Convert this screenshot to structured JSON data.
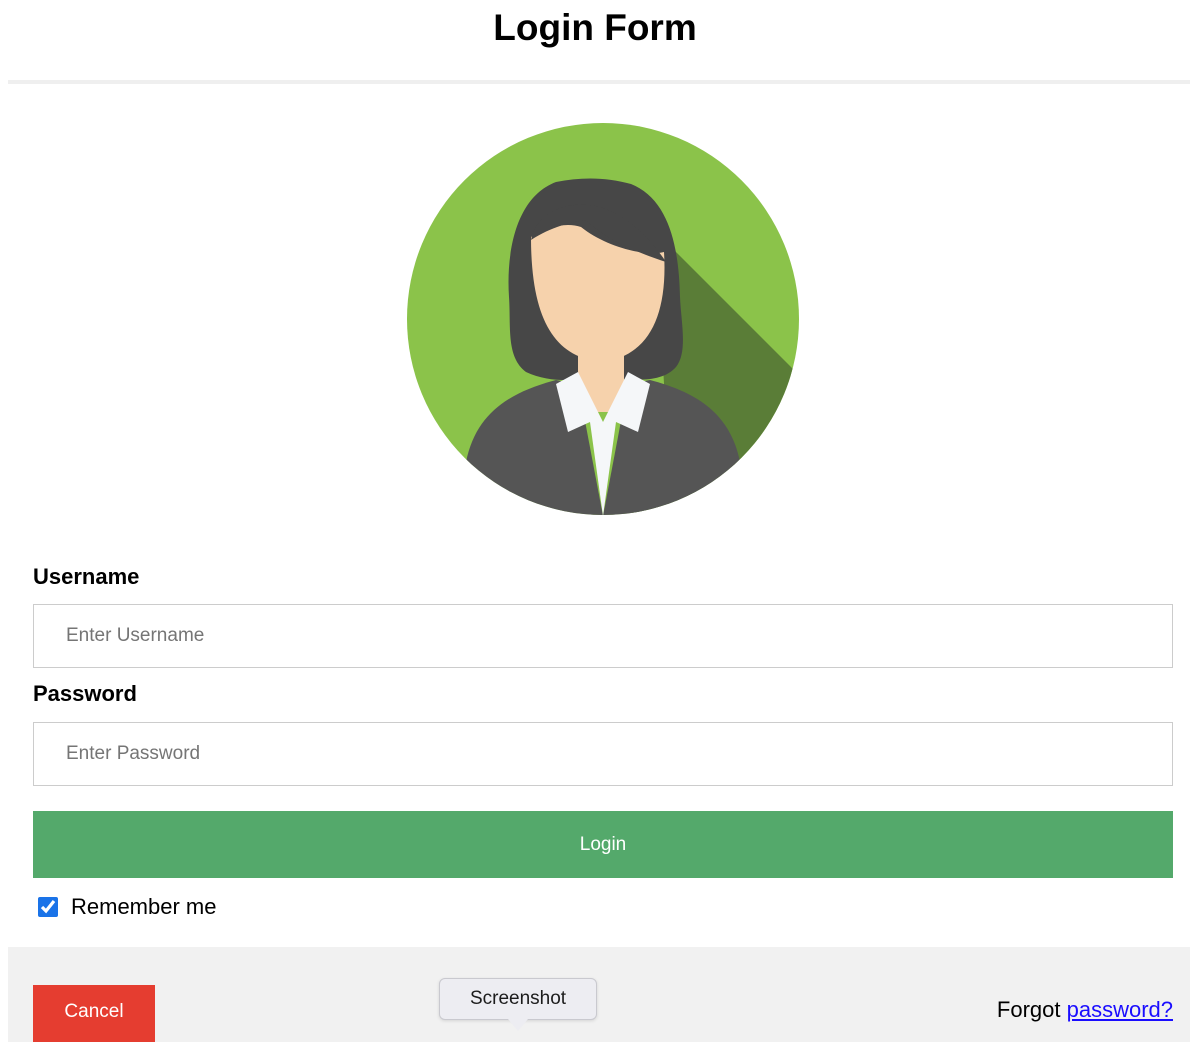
{
  "page": {
    "title": "Login Form"
  },
  "avatar": {
    "icon": "user-avatar-icon",
    "colors": {
      "background": "#8bc34a",
      "hair": "#474747",
      "skin": "#f6d2ac",
      "jacket": "#555555",
      "shirt": "#f5f7f9"
    }
  },
  "form": {
    "username": {
      "label": "Username",
      "placeholder": "Enter Username",
      "value": ""
    },
    "password": {
      "label": "Password",
      "placeholder": "Enter Password",
      "value": ""
    },
    "login_label": "Login",
    "remember": {
      "label": "Remember me",
      "checked": true
    }
  },
  "footer": {
    "cancel_label": "Cancel",
    "forgot_text": "Forgot",
    "forgot_link": "password?"
  },
  "tooltip": {
    "text": "Screenshot"
  },
  "colors": {
    "login_button": "#54a96b",
    "cancel_button": "#e53d30",
    "link": "#1a0dff",
    "footer_background": "#f1f1f1"
  }
}
